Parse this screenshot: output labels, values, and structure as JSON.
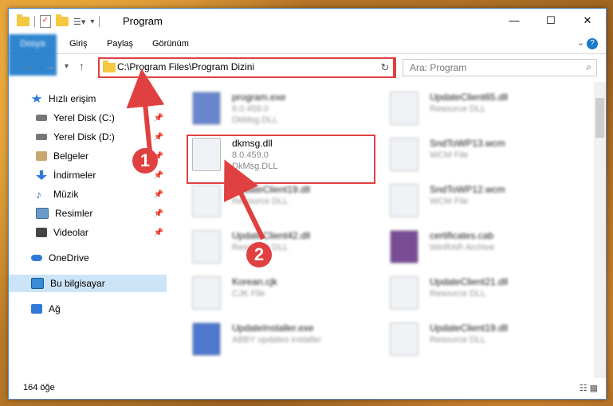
{
  "window": {
    "title": "Program"
  },
  "ribbon": {
    "tabs": [
      "Dosya",
      "Giriş",
      "Paylaş",
      "Görünüm"
    ]
  },
  "address": {
    "path": "C:\\Program Files\\Program Dizini"
  },
  "search": {
    "placeholder": "Ara: Program"
  },
  "sidebar": {
    "items": [
      {
        "label": "Hızlı erişim",
        "icon": "star-icon",
        "color": "#2f7ad8",
        "pinned": false
      },
      {
        "label": "Yerel Disk (C:)",
        "icon": "drive-icon",
        "color": "#555555",
        "pinned": true
      },
      {
        "label": "Yerel Disk (D:)",
        "icon": "drive-icon",
        "color": "#555555",
        "pinned": true
      },
      {
        "label": "Belgeler",
        "icon": "documents-icon",
        "color": "#8a6a3a",
        "pinned": true
      },
      {
        "label": "İndirmeler",
        "icon": "download-icon",
        "color": "#2f7ad8",
        "pinned": true
      },
      {
        "label": "Müzik",
        "icon": "music-icon",
        "color": "#2f7ad8",
        "pinned": true
      },
      {
        "label": "Resimler",
        "icon": "pictures-icon",
        "color": "#3a7ab0",
        "pinned": true
      },
      {
        "label": "Videolar",
        "icon": "videos-icon",
        "color": "#444444",
        "pinned": true
      },
      {
        "label": "OneDrive",
        "icon": "cloud-icon",
        "color": "#2f7ad8",
        "pinned": false
      },
      {
        "label": "Bu bilgisayar",
        "icon": "computer-icon",
        "color": "#3a8ad8",
        "pinned": false
      },
      {
        "label": "Ağ",
        "icon": "network-icon",
        "color": "#2f7ad8",
        "pinned": false
      }
    ]
  },
  "files": [
    {
      "name": "program.exe",
      "l2": "8.0.459.0",
      "l3": "DkMsg.DLL"
    },
    {
      "name": "UpdateClient65.dll",
      "l2": "Resource DLL",
      "l3": ""
    },
    {
      "name": "dkmsg.dll",
      "l2": "8.0.459.0",
      "l3": "DkMsg.DLL"
    },
    {
      "name": "SndToWP13.wcm",
      "l2": "WCM File",
      "l3": ""
    },
    {
      "name": "UpdateClient19.dll",
      "l2": "Resource DLL",
      "l3": ""
    },
    {
      "name": "SndToWP12.wcm",
      "l2": "WCM File",
      "l3": ""
    },
    {
      "name": "UpdateClient42.dll",
      "l2": "Resource DLL",
      "l3": ""
    },
    {
      "name": "certificates.cab",
      "l2": "WinRAR Archive",
      "l3": ""
    },
    {
      "name": "Korean.cjk",
      "l2": "CJK File",
      "l3": ""
    },
    {
      "name": "UpdateClient21.dll",
      "l2": "Resource DLL",
      "l3": ""
    },
    {
      "name": "UpdateInstaller.exe",
      "l2": "ABBY updates installer",
      "l3": ""
    },
    {
      "name": "UpdateClient19.dll",
      "l2": "Resource DLL",
      "l3": ""
    }
  ],
  "status": {
    "count": "164 öğe"
  },
  "badges": [
    "1",
    "2"
  ],
  "colors": {
    "accent": "#1979ca",
    "highlight": "#e04040"
  }
}
